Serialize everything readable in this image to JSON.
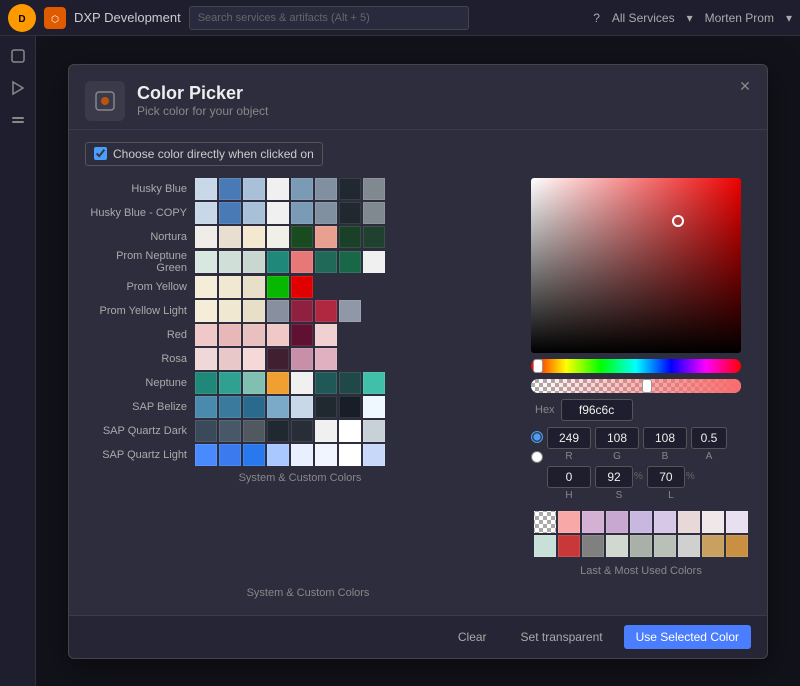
{
  "topbar": {
    "app_name": "DXP Development",
    "search_placeholder": "Search services & artifacts (Alt + 5)",
    "services_label": "All Services",
    "user_label": "Morten Prom"
  },
  "dialog": {
    "title": "Color Picker",
    "subtitle": "Pick color for your object",
    "checkbox_label": "Choose color directly when clicked on",
    "hex_label": "Hex",
    "hex_value": "f96c6c",
    "r_value": "249",
    "g_value": "108",
    "b_value": "108",
    "alpha_value": "0.5",
    "h_value": "0",
    "s_value": "92",
    "l_value": "70",
    "system_label": "System & Custom Colors",
    "recent_label": "Last & Most Used Colors",
    "close_icon": "✕"
  },
  "footer": {
    "clear_label": "Clear",
    "transparent_label": "Set transparent",
    "use_selected_label": "Use Selected Color"
  },
  "swatch_groups": [
    {
      "label": "Husky Blue",
      "colors": [
        "#c8d8e8",
        "#4a7ab5",
        "#a8c0d8",
        "#f0f0f0",
        "#7a9ab5",
        "#8090a0",
        "#202830",
        "#808890"
      ]
    },
    {
      "label": "Husky Blue - COPY",
      "colors": [
        "#c8d8e8",
        "#4a7ab5",
        "#a8c0d8",
        "#f0f0f0",
        "#7a9ab5",
        "#8090a0",
        "#202830",
        "#808890"
      ]
    },
    {
      "label": "Nortura",
      "colors": [
        "#f0ede8",
        "#e8dfd0",
        "#f5e8d0",
        "#f0f0e8",
        "#1a4a20",
        "#e8a090",
        "#1a4028",
        "#204030"
      ]
    },
    {
      "label": "Prom Neptune Green",
      "colors": [
        "#d8e8e0",
        "#d0e0d8",
        "#c8d8d0",
        "#20887a",
        "#e87878",
        "#206858",
        "#186848",
        "#f0f0f0"
      ]
    },
    {
      "label": "Prom Yellow",
      "colors": [
        "#f5edd8",
        "#f0e8d0",
        "#e8dfc8",
        "#08b800",
        "#e00000"
      ]
    },
    {
      "label": "Prom Yellow Light",
      "colors": [
        "#f5edd8",
        "#f0e8d0",
        "#e8dfc8",
        "#8890a0",
        "#902040",
        "#b02840",
        "#9098a8"
      ]
    },
    {
      "label": "Red",
      "colors": [
        "#f0c8c8",
        "#e8b8b8",
        "#e8c0c0",
        "#f0c8c8",
        "#601030",
        "#f0d0d0"
      ]
    },
    {
      "label": "Rosa",
      "colors": [
        "#f0d8d8",
        "#e8c8c8",
        "#f5d8d8",
        "#402030",
        "#c890a8",
        "#e0b0c0"
      ]
    },
    {
      "label": "Neptune",
      "colors": [
        "#208878",
        "#30a090",
        "#80c0b0",
        "#f0a030",
        "#f0f0f0",
        "#205858",
        "#204848",
        "#40c0a8"
      ]
    },
    {
      "label": "SAP Belize",
      "colors": [
        "#4a8aac",
        "#3a7a9c",
        "#2a6a8c",
        "#7aaac8",
        "#c8d8e8",
        "#202830",
        "#181e28",
        "#f0f8ff"
      ]
    },
    {
      "label": "SAP Quartz Dark",
      "colors": [
        "#3a4a5a",
        "#485868",
        "#505860",
        "#202830",
        "#282e38",
        "#f0f0f0",
        "#ffffff",
        "#c8d0d8"
      ]
    },
    {
      "label": "SAP Quartz Light",
      "colors": [
        "#4a8aff",
        "#3a7aee",
        "#2878ee",
        "#a8c8ff",
        "#e8f0ff",
        "#f0f5ff",
        "#ffffff",
        "#c8d8f8"
      ]
    }
  ],
  "recent_rows": [
    {
      "colors": [
        "checker",
        "#f9a8a8",
        "#d4b0d4",
        "#c8a8d0",
        "#c8b8e0",
        "#d8c8e8",
        "#e8d8d8",
        "#f0e8e8",
        "#e8e0f0"
      ]
    },
    {
      "colors": [
        "#c8e0d8",
        "#c83838",
        "#808080",
        "#d0d8d0",
        "#a8b0a8",
        "#b8c0b8",
        "#d0d0d0",
        "#c8a060",
        "#c89040"
      ]
    }
  ]
}
